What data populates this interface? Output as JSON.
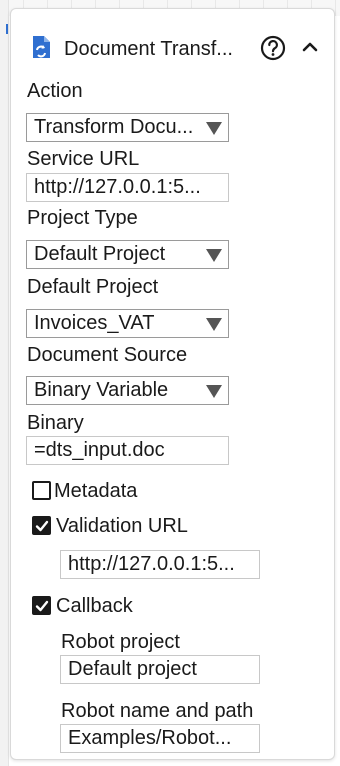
{
  "header": {
    "title": "Document Transf..."
  },
  "action": {
    "label": "Action",
    "value": "Transform Docu..."
  },
  "service_url": {
    "label": "Service URL",
    "value": "http://127.0.0.1:5..."
  },
  "project_type": {
    "label": "Project Type",
    "value": "Default Project"
  },
  "default_project": {
    "label": "Default Project",
    "value": "Invoices_VAT"
  },
  "document_source": {
    "label": "Document Source",
    "value": "Binary Variable"
  },
  "binary": {
    "label": "Binary",
    "value": "=dts_input.doc"
  },
  "metadata": {
    "label": "Metadata",
    "checked": false
  },
  "validation_url": {
    "label": "Validation URL",
    "checked": true,
    "value": "http://127.0.0.1:5..."
  },
  "callback": {
    "label": "Callback",
    "checked": true,
    "robot_project_label": "Robot project",
    "robot_project_value": "Default project",
    "robot_name_label": "Robot name and path",
    "robot_name_value": "Examples/Robot..."
  },
  "colors": {
    "accent": "#2f6fd0",
    "border": "#c8c8c8",
    "text": "#1a1a1a"
  }
}
